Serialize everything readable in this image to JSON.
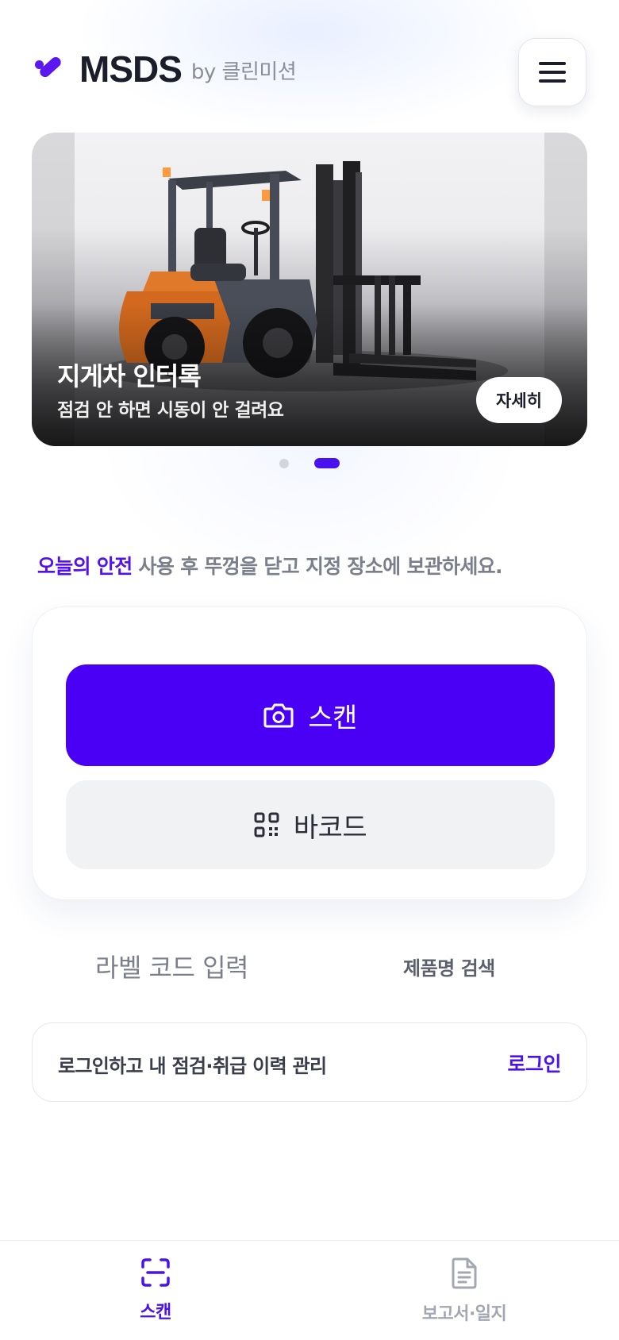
{
  "header": {
    "brand": "MSDS",
    "brand_by": "by 클린미션",
    "menu_icon": "hamburger-menu-icon",
    "accent_color": "#4b00f6"
  },
  "banner": {
    "title": "지게차 인터록",
    "subtitle": "점검 안 하면 시동이 안 걸려요",
    "button_label": "자세히",
    "image": "forklift-photo",
    "slide_count": 2,
    "active_slide": 2
  },
  "tip": {
    "highlight": "오늘의 안전",
    "text": "사용 후 뚜껑을 닫고 지정 장소에 보관하세요."
  },
  "actions": {
    "scan_label": "스캔",
    "scan_icon": "camera-icon",
    "barcode_label": "바코드",
    "barcode_icon": "qr-code-icon"
  },
  "links": {
    "label_code": "라벨 코드 입력",
    "product_search": "제품명 검색"
  },
  "login": {
    "text": "로그인하고 내 점검·취급 이력 관리",
    "link": "로그인"
  },
  "bottom_nav": {
    "items": [
      {
        "label": "스캔",
        "icon": "scan-frame-icon",
        "active": true
      },
      {
        "label": "보고서·일지",
        "icon": "document-icon",
        "active": false
      }
    ]
  }
}
